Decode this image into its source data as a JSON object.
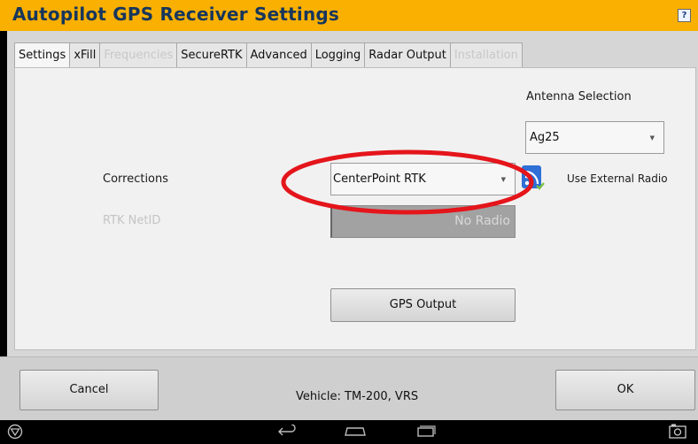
{
  "window": {
    "title": "Autopilot GPS Receiver Settings",
    "help_label": "?"
  },
  "tabs": [
    {
      "label": "Settings",
      "state": "active"
    },
    {
      "label": "xFill",
      "state": "enabled"
    },
    {
      "label": "Frequencies",
      "state": "disabled"
    },
    {
      "label": "SecureRTK",
      "state": "enabled"
    },
    {
      "label": "Advanced",
      "state": "enabled"
    },
    {
      "label": "Logging",
      "state": "enabled"
    },
    {
      "label": "Radar Output",
      "state": "enabled"
    },
    {
      "label": "Installation",
      "state": "disabled"
    }
  ],
  "settings": {
    "antenna": {
      "label": "Antenna Selection",
      "value": "Ag25"
    },
    "corrections": {
      "label": "Corrections",
      "value": "CenterPoint RTK"
    },
    "external_radio": {
      "label": "Use External Radio",
      "icon": "radio-antenna-icon"
    },
    "rtk_netid": {
      "label": "RTK NetID",
      "value": "No Radio",
      "enabled": false
    },
    "gps_output_label": "GPS Output"
  },
  "footer": {
    "cancel_label": "Cancel",
    "ok_label": "OK",
    "vehicle_text": "Vehicle: TM-200, VRS"
  },
  "nav": {
    "icons": [
      "trimble-logo-icon",
      "back-icon",
      "home-icon",
      "recent-apps-icon",
      "screenshot-icon"
    ]
  },
  "colors": {
    "title_bar": "#f9b000",
    "title_text": "#17365c",
    "highlight_ellipse": "#e4151b",
    "radio_icon": "#2f6fd6"
  }
}
